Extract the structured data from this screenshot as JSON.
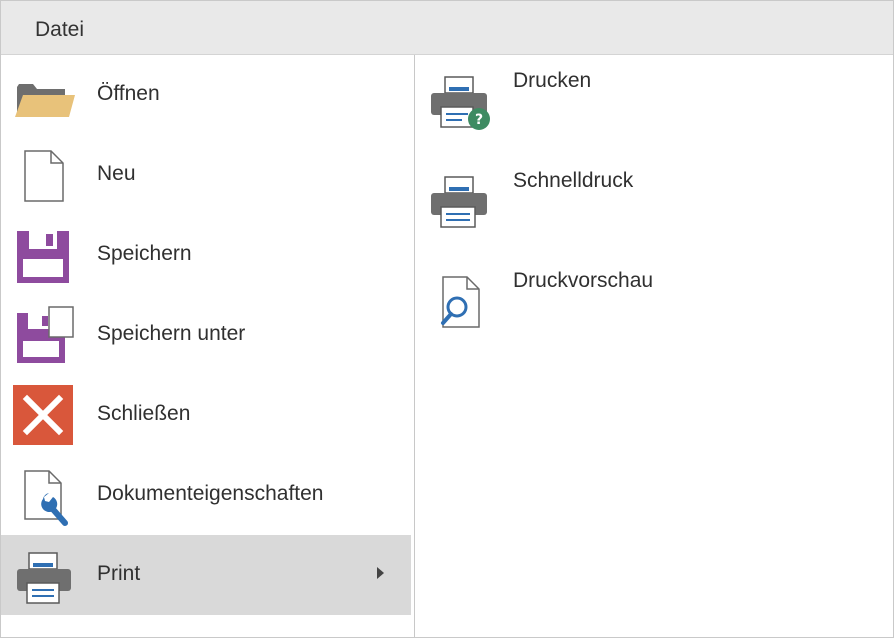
{
  "menubar": {
    "title": "Datei"
  },
  "left_menu": {
    "items": [
      {
        "label": "Öffnen",
        "icon": "folder-open-icon"
      },
      {
        "label": "Neu",
        "icon": "new-document-icon"
      },
      {
        "label": "Speichern",
        "icon": "floppy-disk-icon"
      },
      {
        "label": "Speichern unter",
        "icon": "save-as-icon"
      },
      {
        "label": "Schließen",
        "icon": "close-icon"
      },
      {
        "label": "Dokumenteigenschaften",
        "icon": "document-properties-icon"
      },
      {
        "label": "Print",
        "icon": "printer-icon",
        "selected": true,
        "has_submenu": true
      }
    ]
  },
  "submenu": {
    "items": [
      {
        "label": "Drucken",
        "icon": "print-dialog-icon"
      },
      {
        "label": "Schnelldruck",
        "icon": "quick-print-icon"
      },
      {
        "label": "Druckvorschau",
        "icon": "print-preview-icon"
      }
    ]
  },
  "colors": {
    "menubar_bg": "#e9e9e9",
    "selected_bg": "#d9d9d9",
    "folder": "#e8c27a",
    "save_purple": "#8e4b9e",
    "close_red": "#d9573b",
    "wrench_blue": "#2f6fb3",
    "printer_gray": "#6f6f6f",
    "badge_green": "#3e8b62"
  }
}
